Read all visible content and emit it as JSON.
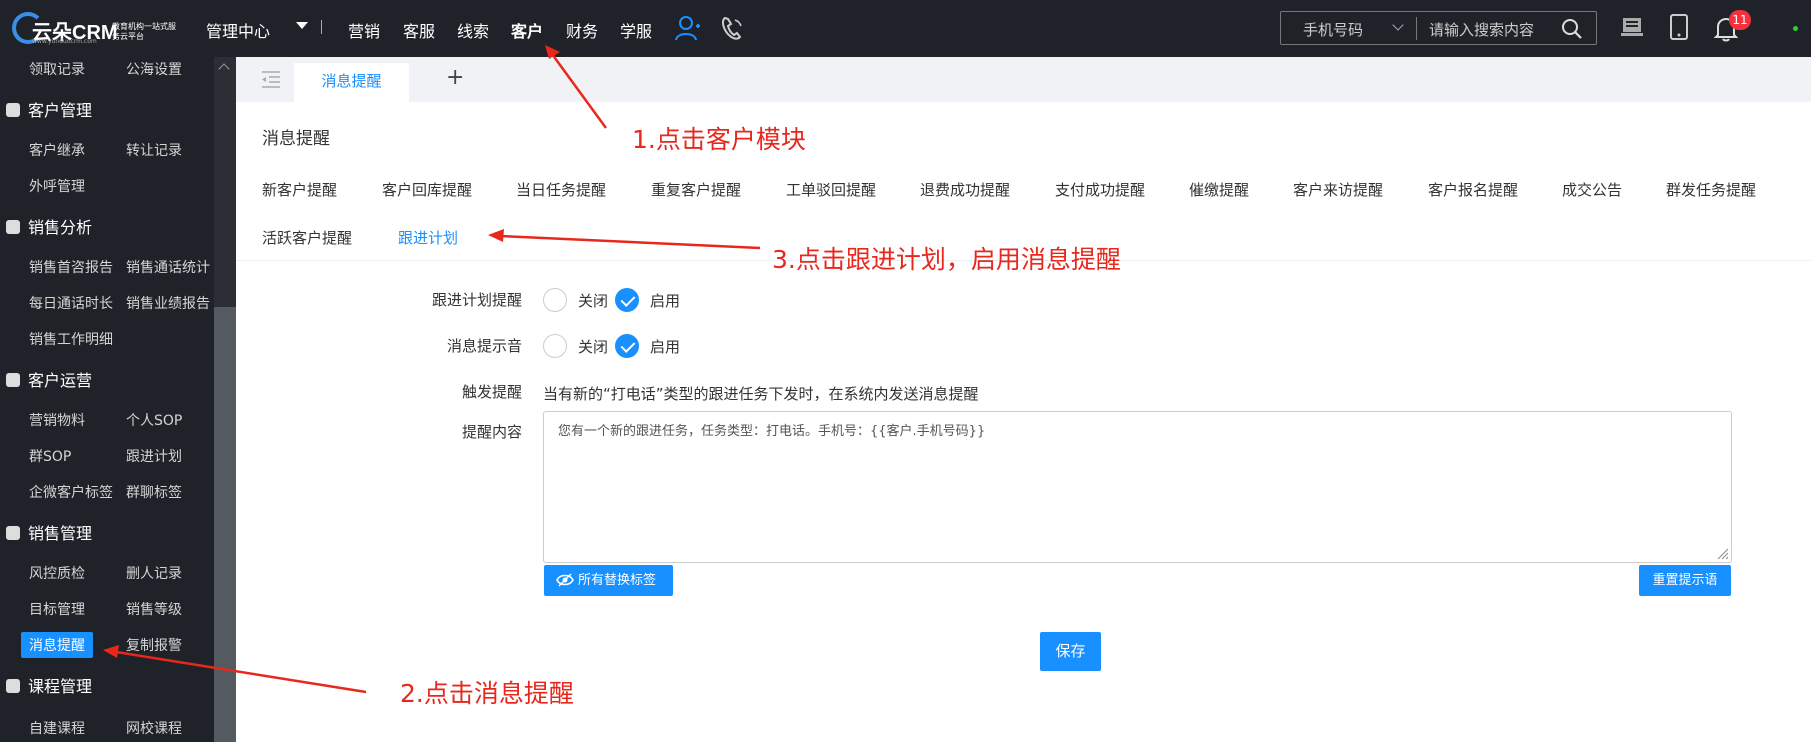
{
  "header": {
    "logo_text": "云朵CRM",
    "logo_sub": "教育机构一站式服务云平台",
    "logo_url": "www.yunduocrm.com",
    "center_label": "管理中心",
    "nav": [
      "营销",
      "客服",
      "线索",
      "客户",
      "财务",
      "学服"
    ],
    "active_nav": "客户",
    "search_select": "手机号码",
    "search_placeholder": "请输入搜索内容",
    "notification_count": "11"
  },
  "sidebar": {
    "top_row": [
      "领取记录",
      "公海设置"
    ],
    "groups": [
      {
        "title": "客户管理",
        "items": [
          "客户继承",
          "转让记录",
          "外呼管理"
        ]
      },
      {
        "title": "销售分析",
        "items": [
          "销售首咨报告",
          "销售通话统计",
          "每日通话时长",
          "销售业绩报告",
          "销售工作明细"
        ]
      },
      {
        "title": "客户运营",
        "items": [
          "营销物料",
          "个人SOP",
          "群SOP",
          "跟进计划",
          "企微客户标签",
          "群聊标签"
        ]
      },
      {
        "title": "销售管理",
        "items": [
          "风控质检",
          "删人记录",
          "目标管理",
          "销售等级",
          "消息提醒",
          "复制报警"
        ]
      },
      {
        "title": "课程管理",
        "items": [
          "自建课程",
          "网校课程"
        ]
      }
    ]
  },
  "tabs": {
    "active": "消息提醒",
    "add": "+"
  },
  "page": {
    "title": "消息提醒",
    "subnav": [
      "新客户提醒",
      "客户回库提醒",
      "当日任务提醒",
      "重复客户提醒",
      "工单驳回提醒",
      "退费成功提醒",
      "支付成功提醒",
      "催缴提醒",
      "客户来访提醒",
      "客户报名提醒",
      "成交公告",
      "群发任务提醒",
      "活跃客户提醒",
      "跟进计划"
    ],
    "active_subnav": "跟进计划"
  },
  "form": {
    "reminder_label": "跟进计划提醒",
    "sound_label": "消息提示音",
    "off": "关闭",
    "on": "启用",
    "trigger_label": "触发提醒",
    "trigger_text": "当有新的“打电话”类型的跟进任务下发时，在系统内发送消息提醒",
    "content_label": "提醒内容",
    "content_value": "您有一个新的跟进任务，任务类型：打电话。手机号：{{客户.手机号码}}",
    "tags_button": "所有替换标签",
    "reset_button": "重置提示语",
    "save_button": "保存"
  },
  "annotations": {
    "step1": "1.点击客户模块",
    "step2": "2.点击消息提醒",
    "step3": "3.点击跟进计划，启用消息提醒"
  },
  "colors": {
    "primary": "#1890ff",
    "dark_bg": "#1f2329",
    "annotation": "#e8281c",
    "badge": "#f5313c"
  }
}
